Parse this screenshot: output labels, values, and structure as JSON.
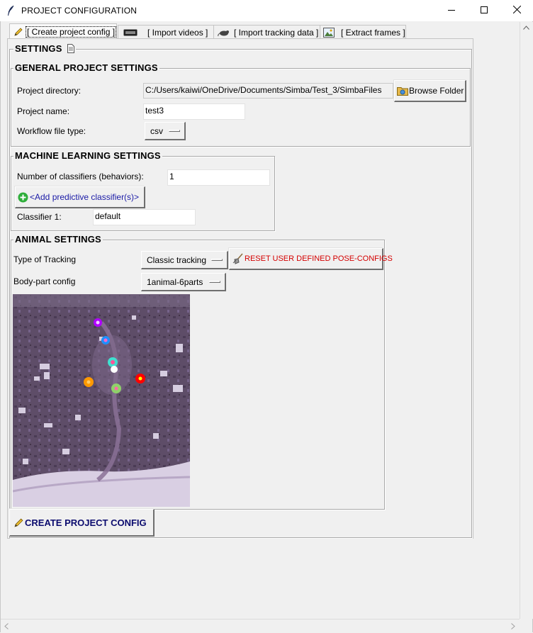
{
  "window": {
    "title": "PROJECT CONFIGURATION"
  },
  "tabs": [
    {
      "label": "[ Create project config ]",
      "icon": "pencil-icon",
      "active": true
    },
    {
      "label": "[ Import videos ]",
      "icon": "video-icon",
      "active": false
    },
    {
      "label": "[ Import tracking data ]",
      "icon": "mouse-icon",
      "active": false
    },
    {
      "label": "[ Extract frames ]",
      "icon": "image-icon",
      "active": false
    }
  ],
  "settings": {
    "title": "SETTINGS"
  },
  "general": {
    "title": "GENERAL PROJECT SETTINGS",
    "project_dir_label": "Project directory:",
    "project_dir_value": "C:/Users/kaiwi/OneDrive/Documents/Simba/Test_3/SimbaFiles",
    "browse_label": "Browse Folder",
    "project_name_label": "Project name:",
    "project_name_value": "test3",
    "workflow_label": "Workflow file type:",
    "workflow_value": "csv"
  },
  "ml": {
    "title": "MACHINE LEARNING SETTINGS",
    "num_classifiers_label": "Number of classifiers (behaviors):",
    "num_classifiers_value": "1",
    "add_classifier_label": "<Add predictive classifier(s)>",
    "classifier1_label": "Classifier 1:",
    "classifier1_value": "default"
  },
  "animal": {
    "title": "ANIMAL SETTINGS",
    "tracking_type_label": "Type of Tracking",
    "tracking_type_value": "Classic tracking",
    "reset_label": "RESET USER DEFINED POSE-CONFIGS",
    "bodypart_label": "Body-part config",
    "bodypart_value": "1animal-6parts"
  },
  "create_button": {
    "label": "CREATE PROJECT CONFIG"
  },
  "colors": {
    "link_blue": "#1a1aa6",
    "reset_red": "#d40000",
    "create_navy": "#0b0b6e",
    "add_green": "#2eae3a"
  }
}
